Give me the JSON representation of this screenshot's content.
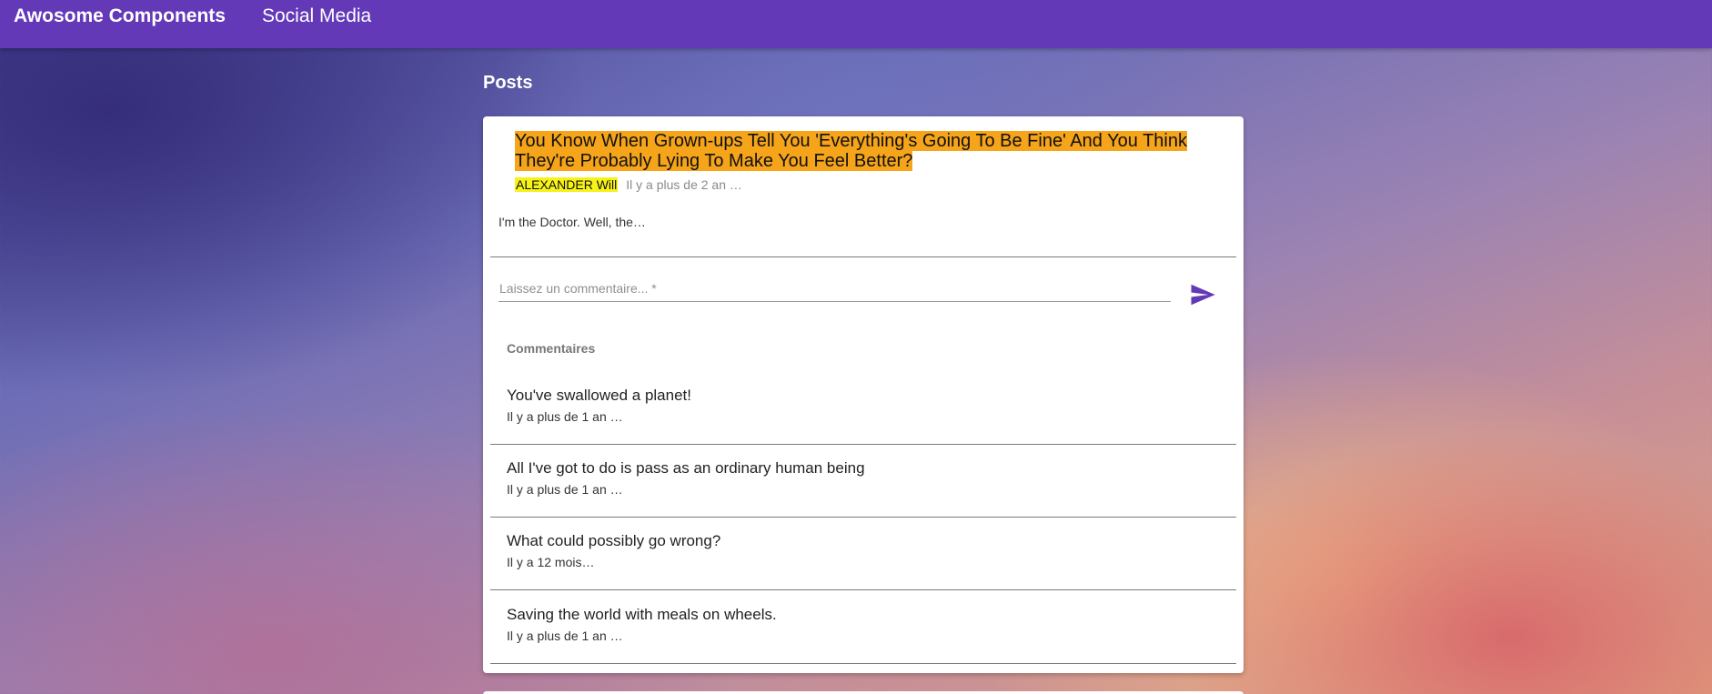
{
  "app_bar": {
    "title": "Awosome Components",
    "nav_link": "Social Media",
    "color": "#6439b8"
  },
  "section": {
    "title": "Posts"
  },
  "post": {
    "title": "You Know When Grown-ups Tell You 'Everything's Going To Be Fine' And You Think They're Probably Lying To Make You Feel Better?",
    "title_highlight_color": "#f6a41a",
    "author": "ALEXANDER Will",
    "author_highlight_color": "#f7f31a",
    "date": "Il y a plus de 2 an …",
    "excerpt": "I'm the Doctor. Well, the…"
  },
  "comment_form": {
    "placeholder": "Laissez un commentaire... *",
    "send_icon": "send-icon",
    "accent_color": "#6439b8"
  },
  "comments": {
    "heading": "Commentaires",
    "items": [
      {
        "text": "You've swallowed a planet!",
        "date": "Il y a plus de 1 an …"
      },
      {
        "text": "All I've got to do is pass as an ordinary human being",
        "date": "Il y a plus de 1 an …"
      },
      {
        "text": "What could possibly go wrong?",
        "date": "Il y a 12 mois…"
      },
      {
        "text": "Saving the world with meals on wheels.",
        "date": "Il y a plus de 1 an …"
      }
    ]
  }
}
